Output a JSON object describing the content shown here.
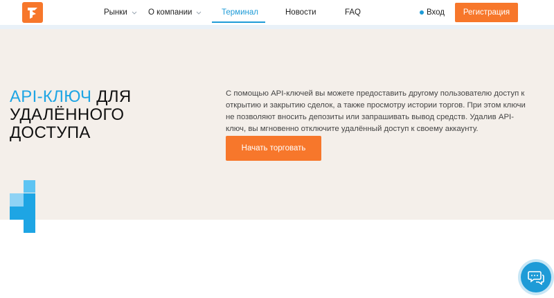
{
  "header": {
    "logo_icon": "logo-mark-icon",
    "nav": [
      {
        "label": "Рынки",
        "has_dropdown": true
      },
      {
        "label": "О компании",
        "has_dropdown": true
      },
      {
        "label": "Терминал",
        "active": true
      },
      {
        "label": "Новости"
      },
      {
        "label": "FAQ"
      }
    ],
    "login_label": "Вход",
    "register_label": "Регистрация"
  },
  "hero": {
    "title_accent": "API-КЛЮЧ",
    "title_rest_1": " ДЛЯ",
    "title_line_2": "УДАЛЁННОГО",
    "title_line_3": "ДОСТУПА",
    "description": "С помощью API-ключей вы можете предоставить другому пользователю доступ к открытию и закрытию сделок, а также просмотру истории торгов. При этом ключи не позволяют вносить депозиты или запрашивать вывод средств. Удалив API-ключ, вы мгновенно отключите удалённый доступ к своему аккаунту.",
    "cta_label": "Начать торговать"
  },
  "chat": {
    "icon": "chat-bubbles-icon"
  },
  "colors": {
    "accent_orange": "#f7772b",
    "accent_blue": "#1e9bd7",
    "hero_bg": "#f4efea"
  }
}
